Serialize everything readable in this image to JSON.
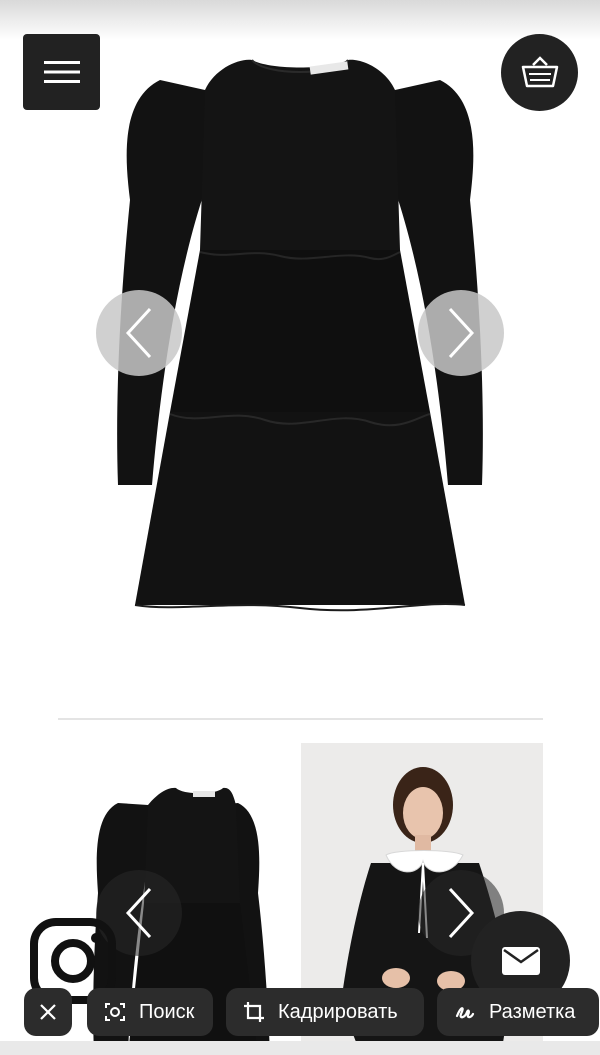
{
  "header": {
    "menu_icon": "hamburger-menu-icon",
    "cart_icon": "basket-icon"
  },
  "product": {
    "hero_image": "black-tiered-dress-photo",
    "thumbnails": [
      "black-dress-front-photo",
      "model-wearing-black-dress-photo"
    ]
  },
  "social": {
    "instagram_icon": "instagram-icon",
    "mail_icon": "mail-icon"
  },
  "lens_bar": {
    "close_icon": "close-icon",
    "search_label": "Поиск",
    "crop_label": "Кадрировать",
    "markup_label": "Разметка"
  },
  "colors": {
    "dark_button": "#222222",
    "chip_bg": "#2c2c2c",
    "divider": "#e4e4e4"
  }
}
